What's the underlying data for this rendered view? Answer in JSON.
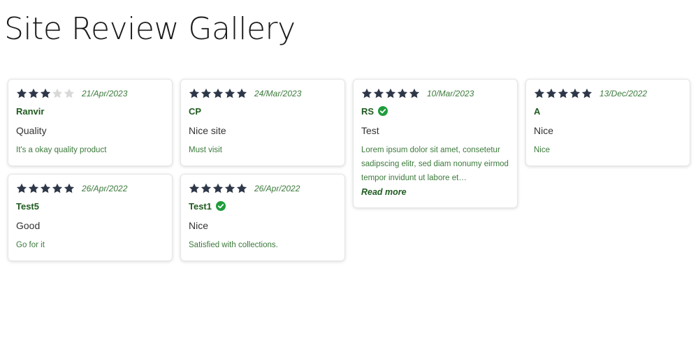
{
  "page": {
    "title": "Site Review Gallery"
  },
  "colors": {
    "star_filled": "#2d3748",
    "star_empty": "#d9d9d9",
    "verified_badge": "#1f9d3c",
    "author_text": "#1f5a1f",
    "body_text": "#3c7a3c"
  },
  "reviews": [
    {
      "rating": 3,
      "date": "21/Apr/2023",
      "author": "Ranvir",
      "verified": false,
      "title": "Quality",
      "body": "It's a okay quality product"
    },
    {
      "rating": 5,
      "date": "24/Mar/2023",
      "author": "CP",
      "verified": false,
      "title": "Nice site",
      "body": "Must visit"
    },
    {
      "rating": 5,
      "date": "10/Mar/2023",
      "author": "RS",
      "verified": true,
      "title": "Test",
      "body": "Lorem ipsum dolor sit amet, consetetur sadipscing elitr, sed diam nonumy eirmod tempor invidunt ut labore et…",
      "read_more": "Read more"
    },
    {
      "rating": 5,
      "date": "13/Dec/2022",
      "author": "A",
      "verified": false,
      "title": "Nice",
      "body": "Nice"
    },
    {
      "rating": 5,
      "date": "26/Apr/2022",
      "author": "Test5",
      "verified": false,
      "title": "Good",
      "body": "Go for it"
    },
    {
      "rating": 5,
      "date": "26/Apr/2022",
      "author": "Test1",
      "verified": true,
      "title": "Nice",
      "body": "Satisfied with collections."
    }
  ]
}
